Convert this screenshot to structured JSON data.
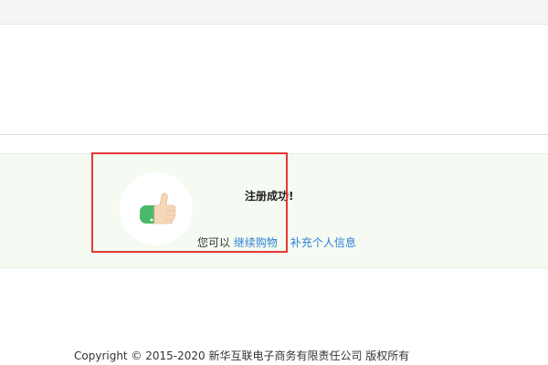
{
  "success": {
    "title": "注册成功!",
    "prefix": "您可以",
    "continue_link": "继续购物",
    "profile_link": "补充个人信息",
    "icon": "thumbs-up-icon"
  },
  "footer": {
    "copyright": "Copyright © 2015-2020 新华互联电子商务有限责任公司 版权所有"
  },
  "colors": {
    "link": "#2e7fd6",
    "panel_bg": "#f5fbf2",
    "highlight": "#e53935",
    "thumb_green": "#4cb86a"
  }
}
